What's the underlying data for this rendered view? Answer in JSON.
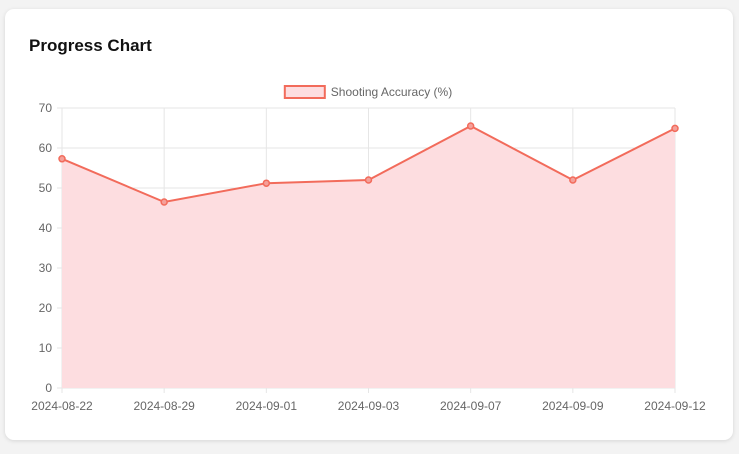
{
  "card": {
    "title": "Progress Chart"
  },
  "colors": {
    "line": "#f26b5b",
    "fill": "#fddde0",
    "grid": "#e6e6e6",
    "text": "#666666",
    "point_fill": "#f4a09a"
  },
  "chart_data": {
    "type": "area",
    "x": [
      "2024-08-22",
      "2024-08-29",
      "2024-09-01",
      "2024-09-03",
      "2024-09-07",
      "2024-09-09",
      "2024-09-12"
    ],
    "series": [
      {
        "name": "Shooting Accuracy (%)",
        "values": [
          57.3,
          46.5,
          51.2,
          52.0,
          65.5,
          52.0,
          64.9
        ]
      }
    ],
    "ylim": [
      0,
      70
    ],
    "yticks": [
      0,
      10,
      20,
      30,
      40,
      50,
      60,
      70
    ],
    "grid": true,
    "legend_position": "top-center"
  }
}
